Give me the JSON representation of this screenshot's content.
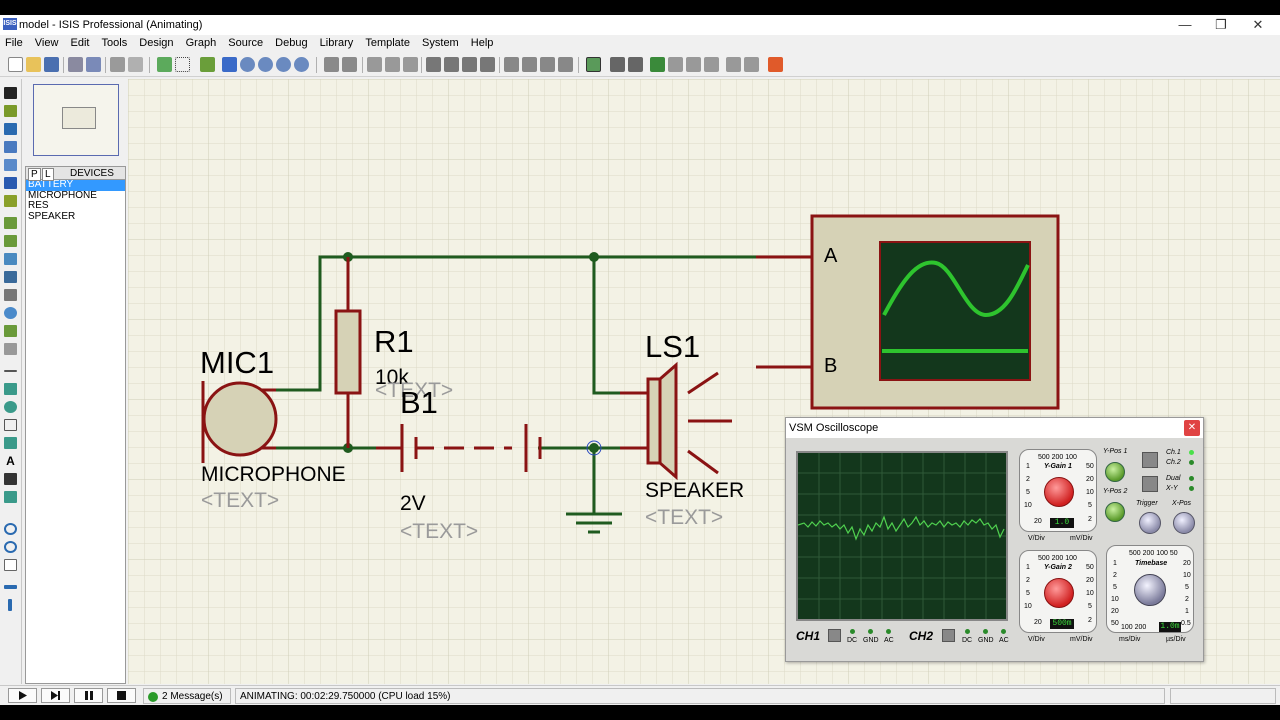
{
  "window": {
    "title": "model - ISIS Professional (Animating)",
    "app_icon_text": "ISIS",
    "min": "—",
    "max": "❐",
    "close": "✕"
  },
  "menu": [
    "File",
    "Edit",
    "View",
    "Tools",
    "Design",
    "Graph",
    "Source",
    "Debug",
    "Library",
    "Template",
    "System",
    "Help"
  ],
  "device_panel": {
    "tab_p": "P",
    "tab_l": "L",
    "header": "DEVICES",
    "items": [
      "BATTERY",
      "MICROPHONE",
      "RES",
      "SPEAKER"
    ],
    "selected_index": 0
  },
  "schematic": {
    "mic": {
      "ref": "MIC1",
      "value": "MICROPHONE",
      "text": "<TEXT>"
    },
    "resistor": {
      "ref": "R1",
      "value": "10k",
      "text": "<TEXT>"
    },
    "battery": {
      "ref": "B1",
      "value": "2V",
      "text": "<TEXT>"
    },
    "speaker": {
      "ref": "LS1",
      "value": "SPEAKER",
      "text": "<TEXT>"
    },
    "scope_inputs": {
      "a": "A",
      "b": "B"
    }
  },
  "oscilloscope": {
    "title": "VSM Oscilloscope",
    "close": "✕",
    "ygain1": {
      "label": "Y-Gain 1",
      "top": "500 200 100",
      "left_scale": [
        "1",
        "2",
        "5",
        "10",
        "20"
      ],
      "right_scale": [
        "50",
        "20",
        "10",
        "5",
        "2"
      ],
      "display": "1.0",
      "unit_left": "V/Div",
      "unit_right": "mV/Div"
    },
    "ygain2": {
      "label": "Y-Gain 2",
      "top": "500 200 100",
      "left_scale": [
        "1",
        "2",
        "5",
        "10",
        "20"
      ],
      "right_scale": [
        "50",
        "20",
        "10",
        "5",
        "2"
      ],
      "display": "500m",
      "unit_left": "V/Div",
      "unit_right": "mV/Div"
    },
    "timebase": {
      "label": "Timebase",
      "top": "500 200 100 50",
      "left_scale": [
        "1",
        "2",
        "5",
        "10",
        "20",
        "50"
      ],
      "right_scale": [
        "20",
        "10",
        "5",
        "2",
        "1",
        "0.5"
      ],
      "bottom": "100 200",
      "display": "1.0m",
      "unit_left": "ms/Div",
      "unit_right": "µs/Div"
    },
    "labels": {
      "ypos1": "Y-Pos 1",
      "ypos2": "Y-Pos 2",
      "trigger": "Trigger",
      "xpos": "X-Pos",
      "ch1": "Ch.1",
      "ch2": "Ch.2",
      "dual": "Dual",
      "xy": "X-Y"
    },
    "channels": [
      {
        "name": "CH1",
        "modes": [
          "DC",
          "GND",
          "AC"
        ]
      },
      {
        "name": "CH2",
        "modes": [
          "DC",
          "GND",
          "AC"
        ]
      }
    ]
  },
  "status": {
    "messages": "2 Message(s)",
    "animating": "ANIMATING: 00:02:29.750000 (CPU load 15%)"
  },
  "colors": {
    "wire": "#1f5b1f",
    "component": "#8a1313",
    "component_fill": "#d6d2b6",
    "grid_bg": "#f3f2e5",
    "trace": "#2ec42e"
  }
}
